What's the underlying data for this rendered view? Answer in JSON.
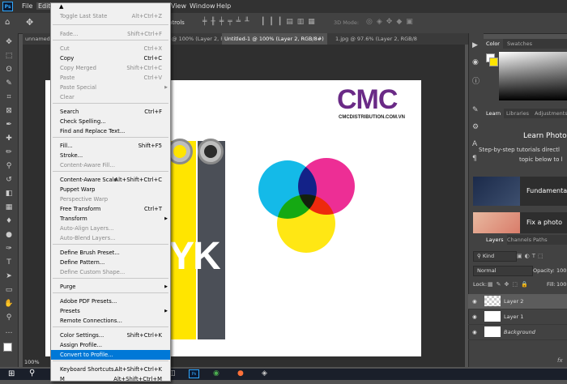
{
  "app": {
    "logo": "Ps"
  },
  "menubar": {
    "items": [
      "File",
      "Edit",
      "View",
      "Window",
      "Help"
    ]
  },
  "options": {
    "controls_label": "ntrols",
    "mode_3d": "3D Mode:"
  },
  "tabs": [
    {
      "label": "unnamed.p..."
    },
    {
      "label": "@ 100% (Layer 2, RGB/8"
    },
    {
      "label": "Untitled-1 @ 100% (Layer 2, RGB/8#)"
    },
    {
      "label": "1.jpg @ 97.6% (Layer 2, RGB/8"
    }
  ],
  "menu": {
    "items": [
      {
        "label": "Toggle Last State",
        "shortcut": "Alt+Ctrl+Z",
        "disabled": true
      },
      {
        "label": "Fade...",
        "shortcut": "Shift+Ctrl+F",
        "disabled": true
      },
      {
        "label": "Cut",
        "shortcut": "Ctrl+X",
        "disabled": true
      },
      {
        "label": "Copy",
        "shortcut": "Ctrl+C",
        "disabled": false
      },
      {
        "label": "Copy Merged",
        "shortcut": "Shift+Ctrl+C",
        "disabled": true
      },
      {
        "label": "Paste",
        "shortcut": "Ctrl+V",
        "disabled": true
      },
      {
        "label": "Paste Special",
        "shortcut": "",
        "disabled": true
      },
      {
        "label": "Clear",
        "shortcut": "",
        "disabled": true
      },
      {
        "label": "Search",
        "shortcut": "Ctrl+F",
        "disabled": false
      },
      {
        "label": "Check Spelling...",
        "shortcut": "",
        "disabled": false
      },
      {
        "label": "Find and Replace Text...",
        "shortcut": "",
        "disabled": false
      },
      {
        "label": "Fill...",
        "shortcut": "Shift+F5",
        "disabled": false
      },
      {
        "label": "Stroke...",
        "shortcut": "",
        "disabled": false
      },
      {
        "label": "Content-Aware Fill...",
        "shortcut": "",
        "disabled": true
      },
      {
        "label": "Content-Aware Scale",
        "shortcut": "Alt+Shift+Ctrl+C",
        "disabled": false
      },
      {
        "label": "Puppet Warp",
        "shortcut": "",
        "disabled": false
      },
      {
        "label": "Perspective Warp",
        "shortcut": "",
        "disabled": true
      },
      {
        "label": "Free Transform",
        "shortcut": "Ctrl+T",
        "disabled": false
      },
      {
        "label": "Transform",
        "shortcut": "",
        "disabled": false
      },
      {
        "label": "Auto-Align Layers...",
        "shortcut": "",
        "disabled": true
      },
      {
        "label": "Auto-Blend Layers...",
        "shortcut": "",
        "disabled": true
      },
      {
        "label": "Define Brush Preset...",
        "shortcut": "",
        "disabled": false
      },
      {
        "label": "Define Pattern...",
        "shortcut": "",
        "disabled": false
      },
      {
        "label": "Define Custom Shape...",
        "shortcut": "",
        "disabled": true
      },
      {
        "label": "Purge",
        "shortcut": "",
        "disabled": false
      },
      {
        "label": "Adobe PDF Presets...",
        "shortcut": "",
        "disabled": false
      },
      {
        "label": "Presets",
        "shortcut": "",
        "disabled": false
      },
      {
        "label": "Remote Connections...",
        "shortcut": "",
        "disabled": false
      },
      {
        "label": "Color Settings...",
        "shortcut": "Shift+Ctrl+K",
        "disabled": false
      },
      {
        "label": "Assign Profile...",
        "shortcut": "",
        "disabled": false
      },
      {
        "label": "Convert to Profile...",
        "shortcut": "",
        "disabled": false
      },
      {
        "label": "Keyboard Shortcuts...",
        "shortcut": "Alt+Shift+Ctrl+K",
        "disabled": false
      },
      {
        "label": "M",
        "shortcut": "Alt+Shift+Ctrl+M",
        "disabled": false
      }
    ]
  },
  "canvas": {
    "logo_text": "CMC",
    "logo_url": "CMCDISTRIBUTION.COM.VN",
    "big_letters": "YK"
  },
  "status": {
    "zoom": "100%"
  },
  "color_panel": {
    "tabs": [
      "Color",
      "Swatches"
    ]
  },
  "learn_panel": {
    "tabs": [
      "Learn",
      "Libraries",
      "Adjustments"
    ],
    "heading": "Learn Photos",
    "subtitle_line1": "Step-by-step tutorials directl",
    "subtitle_line2": "topic below to l",
    "cards": [
      "Fundamental",
      "Fix a photo"
    ]
  },
  "layers_panel": {
    "tabs": [
      "Layers",
      "Channels",
      "Paths"
    ],
    "filter_label": "Kind",
    "blend_mode": "Normal",
    "opacity_label": "Opacity:",
    "opacity_value": "100",
    "lock_label": "Lock:",
    "fill_label": "Fill:",
    "fill_value": "100",
    "layers": [
      {
        "name": "Layer 2",
        "selected": true
      },
      {
        "name": "Layer 1",
        "selected": false
      },
      {
        "name": "Background",
        "selected": false
      }
    ],
    "fx_label": "fx"
  },
  "colors": {
    "cyan": "#00b4e6",
    "magenta": "#ec1c8c",
    "yellow": "#ffe500",
    "highlight": "#0078d7"
  }
}
